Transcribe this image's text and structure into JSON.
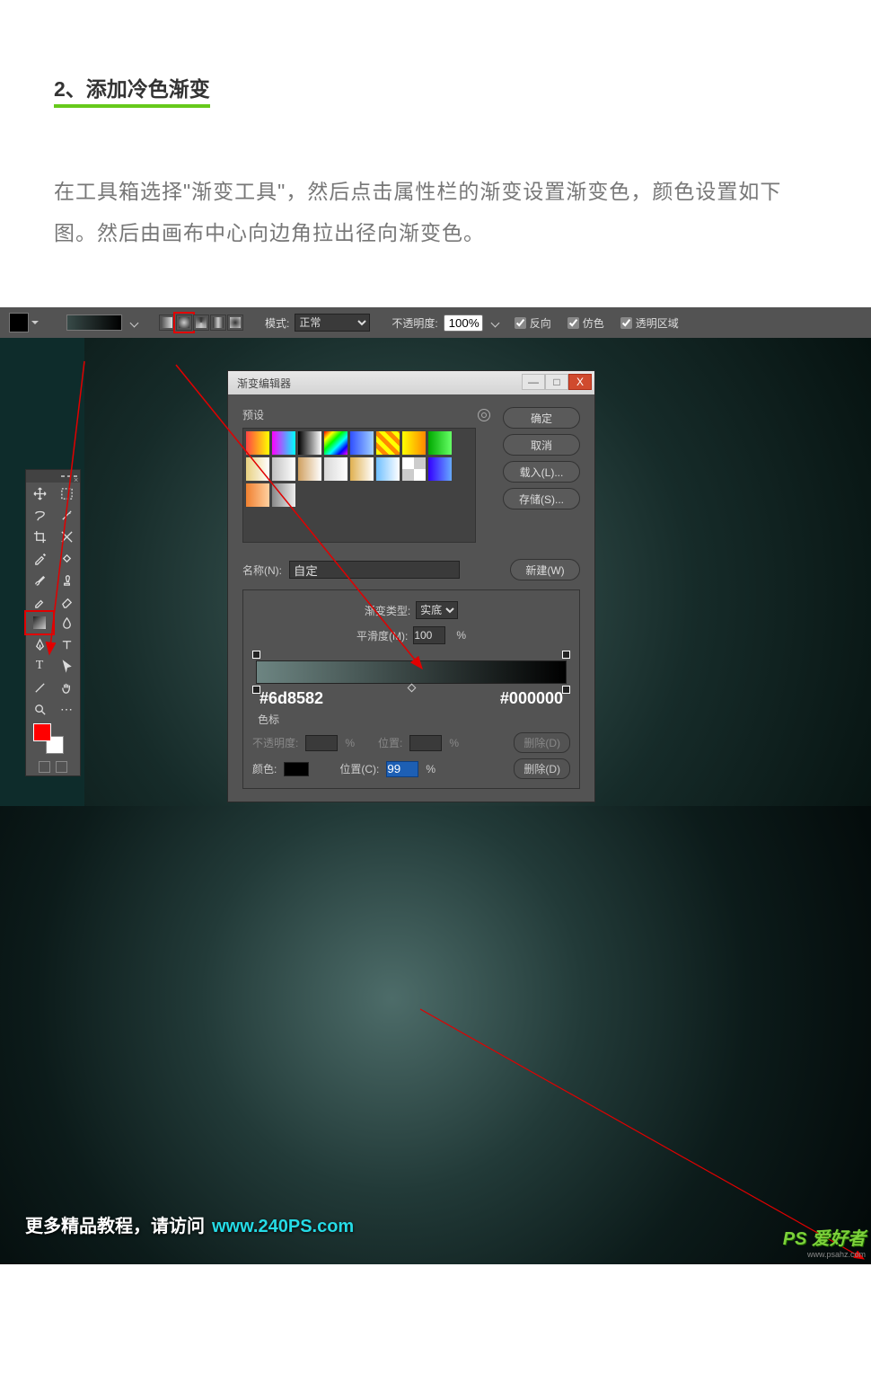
{
  "article": {
    "section_title": "2、添加冷色渐变",
    "body": "在工具箱选择\"渐变工具\"，然后点击属性栏的渐变设置渐变色，颜色设置如下图。然后由画布中心向边角拉出径向渐变色。"
  },
  "options_bar": {
    "mode_label": "模式:",
    "mode_value": "正常",
    "opacity_label": "不透明度:",
    "opacity_value": "100%",
    "reverse": "反向",
    "dither": "仿色",
    "transparency": "透明区域"
  },
  "gradient_editor": {
    "title": "渐变编辑器",
    "presets_label": "预设",
    "ok": "确定",
    "cancel": "取消",
    "load": "载入(L)...",
    "save": "存储(S)...",
    "name_label": "名称(N):",
    "name_value": "自定",
    "new_btn": "新建(W)",
    "type_label": "渐变类型:",
    "type_value": "实底",
    "smooth_label": "平滑度(M):",
    "smooth_value": "100",
    "pct": "%",
    "stop_left_hex": "#6d8582",
    "stop_right_hex": "#000000",
    "stops_label": "色标",
    "opacity_row_label": "不透明度:",
    "position_label": "位置:",
    "delete_btn": "删除(D)",
    "color_label": "颜色:",
    "position2_label": "位置(C):",
    "position2_value": "99",
    "preset_swatches": [
      "linear-gradient(90deg,#f44,#ff0)",
      "linear-gradient(90deg,#f0f,#0ff)",
      "linear-gradient(90deg,#000,#fff)",
      "linear-gradient(135deg,#f00,#ff0,#0f0,#0ff,#00f,#f0f)",
      "linear-gradient(90deg,#3050ff,#a0d0ff)",
      "repeating-linear-gradient(45deg,#ff0 0 5px,#f80 5px 10px)",
      "linear-gradient(90deg,#ff0,#f80)",
      "linear-gradient(90deg,#0a0,#6f6)",
      "linear-gradient(90deg,#e8d080,#fff)",
      "linear-gradient(90deg,#c0c0c0,#fff)",
      "linear-gradient(90deg,#d0a060,#fff)",
      "linear-gradient(90deg,#d8d8d8,#fff)",
      "linear-gradient(90deg,#e0b050,#fff)",
      "linear-gradient(90deg,#70c0ff,#fff)",
      "repeating-conic-gradient(#ccc 0 25%,#fff 0 50%)",
      "linear-gradient(90deg,#30f,#6af)",
      "linear-gradient(90deg,#f08030,#ffd0a0)",
      "linear-gradient(90deg,#888,#eee)"
    ]
  },
  "credit": {
    "prefix": "更多精品教程，请访问",
    "url": "www.240PS.com"
  },
  "watermark": {
    "brand": "PS 爱好者",
    "url": "www.psahz.com"
  }
}
